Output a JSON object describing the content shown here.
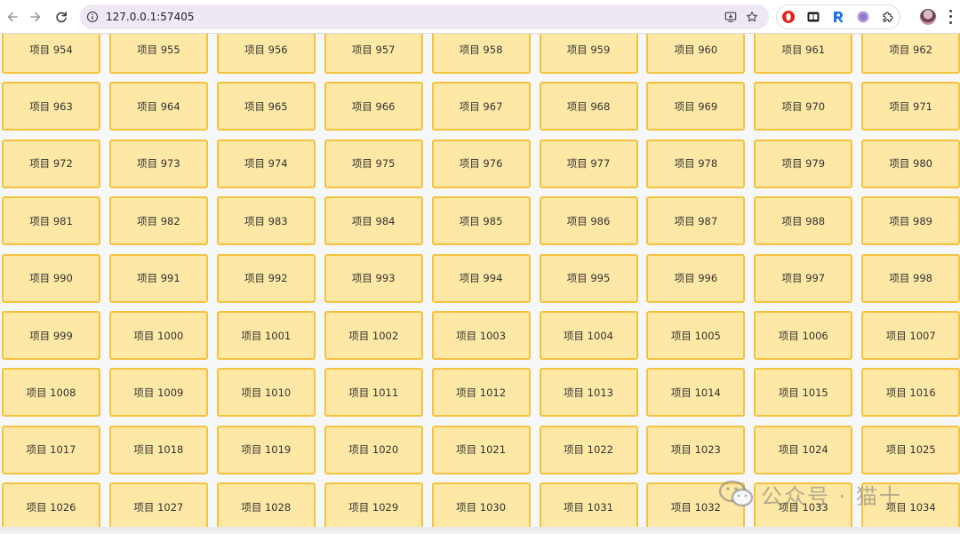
{
  "browser": {
    "url": "127.0.0.1:57405"
  },
  "items": {
    "prefix": "项目",
    "first": 954,
    "last": 1034
  },
  "watermark": {
    "text": "公众号 · 猫十"
  },
  "colors": {
    "card_bg": "#fde8a5",
    "card_border": "#f4c23e",
    "page_bg": "#f6f7f9"
  }
}
